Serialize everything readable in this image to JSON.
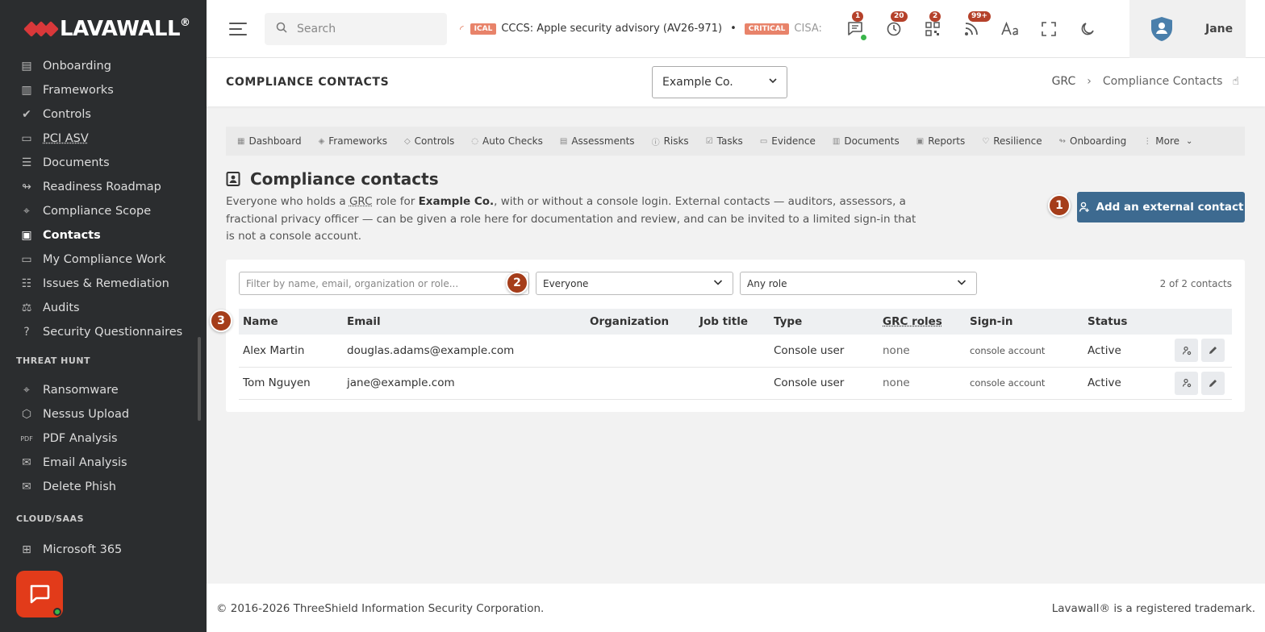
{
  "brand": {
    "name_part1": "LAVA",
    "name_part2": "WALL",
    "reg": "®"
  },
  "sidebar": {
    "items": [
      {
        "label": "Onboarding",
        "icon": "onboarding-icon"
      },
      {
        "label": "Frameworks",
        "icon": "frameworks-icon"
      },
      {
        "label": "Controls",
        "icon": "controls-icon"
      },
      {
        "label": "PCI ASV",
        "icon": "pci-icon"
      },
      {
        "label": "Documents",
        "icon": "documents-icon"
      },
      {
        "label": "Readiness Roadmap",
        "icon": "roadmap-icon"
      },
      {
        "label": "Compliance Scope",
        "icon": "scope-icon"
      },
      {
        "label": "Contacts",
        "icon": "contacts-icon",
        "active": true
      },
      {
        "label": "My Compliance Work",
        "icon": "inbox-icon"
      },
      {
        "label": "Issues & Remediation",
        "icon": "issues-icon"
      },
      {
        "label": "Audits",
        "icon": "audits-icon"
      },
      {
        "label": "Security Questionnaires",
        "icon": "questionnaire-icon"
      }
    ],
    "section_threat": "THREAT HUNT",
    "threat_items": [
      {
        "label": "Ransomware",
        "icon": "crosshair-icon"
      },
      {
        "label": "Nessus Upload",
        "icon": "nessus-icon"
      },
      {
        "label": "PDF Analysis",
        "icon": "pdf-icon"
      },
      {
        "label": "Email Analysis",
        "icon": "email-check-icon"
      },
      {
        "label": "Delete Phish",
        "icon": "email-delete-icon"
      }
    ],
    "section_cloud": "CLOUD/SAAS",
    "cloud_items": [
      {
        "label": "Microsoft 365",
        "icon": "grid-icon"
      }
    ]
  },
  "topbar": {
    "search_placeholder": "Search",
    "ticker": {
      "badge1": "ICAL",
      "item1": "CCCS: Apple security advisory (AV26-971)",
      "sep": "•",
      "badge2": "CRITICAL",
      "item2": "CISA: CV",
      "close": "×"
    },
    "counts": {
      "messages": "1",
      "alerts": "20",
      "qr": "2",
      "feeds": "99+"
    },
    "user_name": "Jane"
  },
  "header": {
    "title": "COMPLIANCE CONTACTS",
    "org": "Example Co.",
    "breadcrumb_root": "GRC",
    "breadcrumb_arrow": "›",
    "breadcrumb_current": "Compliance Contacts"
  },
  "tabs": [
    {
      "label": "Dashboard",
      "icon": "dashboard-icon"
    },
    {
      "label": "Frameworks",
      "icon": "frameworks-icon"
    },
    {
      "label": "Controls",
      "icon": "controls-icon"
    },
    {
      "label": "Auto Checks",
      "icon": "auto-check-icon"
    },
    {
      "label": "Assessments",
      "icon": "assessments-icon"
    },
    {
      "label": "Risks",
      "icon": "risks-icon"
    },
    {
      "label": "Tasks",
      "icon": "tasks-icon"
    },
    {
      "label": "Evidence",
      "icon": "evidence-icon"
    },
    {
      "label": "Documents",
      "icon": "documents-icon"
    },
    {
      "label": "Reports",
      "icon": "reports-icon"
    },
    {
      "label": "Resilience",
      "icon": "resilience-icon"
    },
    {
      "label": "Onboarding",
      "icon": "onboarding-icon"
    },
    {
      "label": "More",
      "icon": "more-icon"
    }
  ],
  "section": {
    "heading": "Compliance contacts",
    "desc_1": "Everyone who holds a ",
    "desc_abbr": "GRC",
    "desc_2": " role for ",
    "desc_org": "Example Co.",
    "desc_3": ", with or without a console login. External contacts — auditors, assessors, a fractional privacy officer — can be given a role here for documentation and review, and can be invited to a limited sign-in that is not a console account."
  },
  "add_button": "Add an external contact",
  "markers": {
    "m1": "1",
    "m2": "2",
    "m3": "3"
  },
  "filters": {
    "search_placeholder": "Filter by name, email, organization or role...",
    "type_value": "Everyone",
    "role_value": "Any role",
    "count": "2 of 2 contacts"
  },
  "table": {
    "headers": {
      "name": "Name",
      "email": "Email",
      "org": "Organization",
      "job": "Job title",
      "type": "Type",
      "grc": "GRC roles",
      "signin": "Sign-in",
      "status": "Status"
    },
    "rows": [
      {
        "name": "Alex Martin",
        "email": "douglas.adams@example.com",
        "org": "",
        "job": "",
        "type": "Console user",
        "grc": "none",
        "signin": "console account",
        "status": "Active"
      },
      {
        "name": "Tom Nguyen",
        "email": "jane@example.com",
        "org": "",
        "job": "",
        "type": "Console user",
        "grc": "none",
        "signin": "console account",
        "status": "Active"
      }
    ]
  },
  "footer": {
    "copyright": "© 2016-2026 ThreeShield Information Security Corporation.",
    "trademark": "Lavawall® is a registered trademark."
  },
  "colors": {
    "sidebar_bg": "#2b2d2f",
    "primary": "#3d6a90",
    "marker": "#a53d1a",
    "alert": "#e23b1a"
  }
}
